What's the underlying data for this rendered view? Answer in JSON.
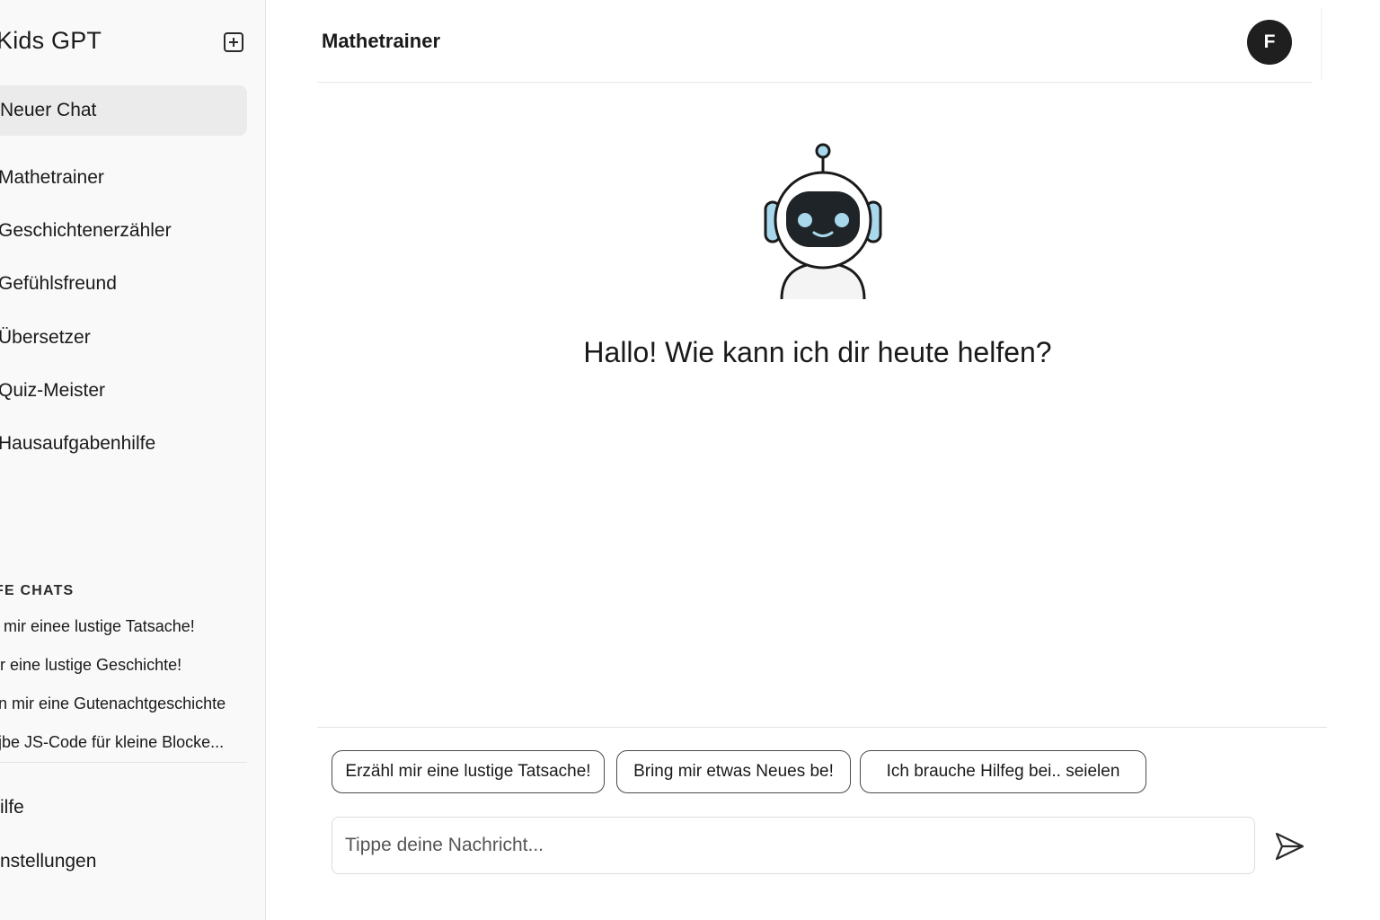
{
  "app": {
    "title": "Kids GPT",
    "new_chat_icon": "plus-square-icon"
  },
  "sidebar": {
    "new_chat_label": "Neuer Chat",
    "assistants": [
      "Mathetrainer",
      "Geschichtenerzähler",
      "Gefühlsfreund",
      "Übersetzer",
      "Quiz-Meister",
      "Hausaufgabenhilfe"
    ],
    "recent_label": "FE CHATS",
    "recent_chats": [
      "mir einee lustige Tatsache!",
      "r eine lustige Geschichte!",
      "n mir eine Gutenachtgeschichte",
      "jbe JS-Code für kleine Blocke..."
    ],
    "footer": [
      "ilfe",
      "nstellungen"
    ]
  },
  "header": {
    "title": "Mathetrainer",
    "avatar_initial": "F"
  },
  "main": {
    "mascot_icon": "robot-icon",
    "greeting": "Hallo! Wie kann ich dir heute helfen?"
  },
  "suggestions": [
    "Erzähl mir eine lustige Tatsache!",
    "Bring mir etwas Neues be!",
    "Ich brauche Hilfeg bei.. seielen"
  ],
  "composer": {
    "placeholder": "Tippe deine Nachricht...",
    "send_icon": "send-icon"
  },
  "colors": {
    "sidebar_bg": "#f9f9f9",
    "active_item_bg": "#ebebeb",
    "avatar_bg": "#1f1f1f",
    "robot_accent": "#a9d8ec"
  }
}
